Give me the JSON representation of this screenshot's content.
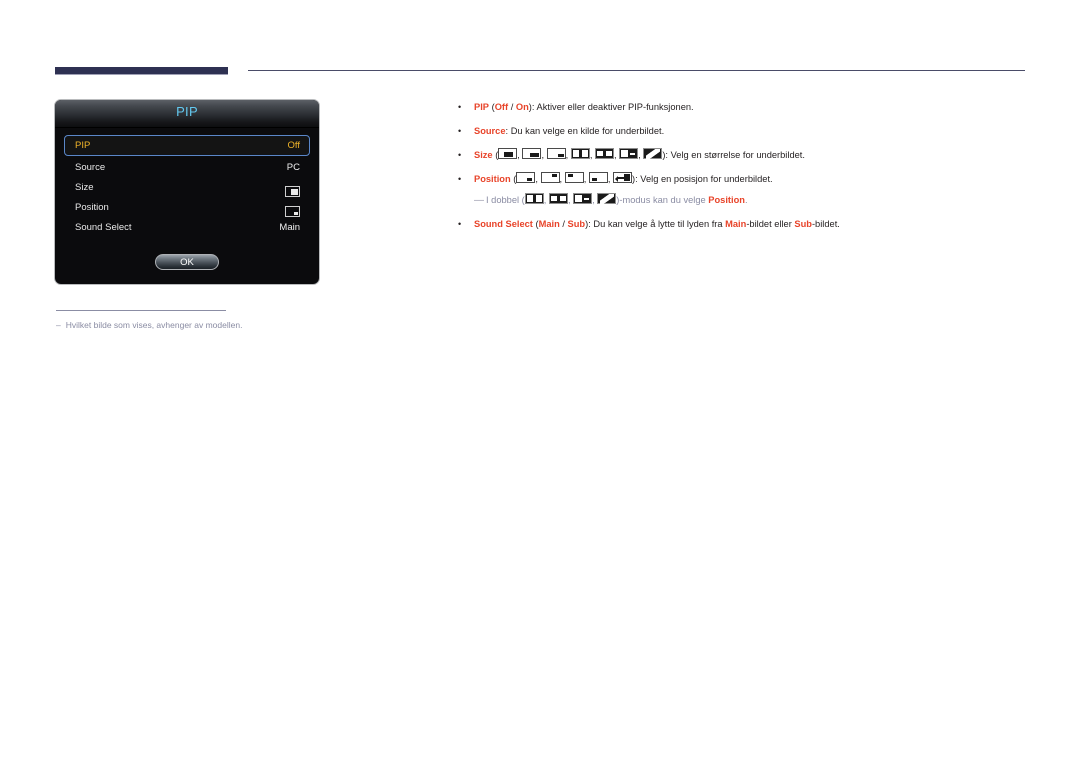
{
  "header": {
    "accent_color": "#2e3152",
    "rule_color": "#4a4c68"
  },
  "osd_dialog": {
    "title": "PIP",
    "title_color": "#63c9f0",
    "selected_color": "#f0b429",
    "rows": [
      {
        "label": "PIP",
        "value": "Off",
        "value_type": "text",
        "selected": true
      },
      {
        "label": "Source",
        "value": "PC",
        "value_type": "text",
        "selected": false
      },
      {
        "label": "Size",
        "value": "",
        "value_type": "icon-size",
        "selected": false
      },
      {
        "label": "Position",
        "value": "",
        "value_type": "icon-position",
        "selected": false
      },
      {
        "label": "Sound Select",
        "value": "Main",
        "value_type": "text",
        "selected": false
      }
    ],
    "ok_label": "OK"
  },
  "footnote": {
    "dash": "–",
    "text": "Hvilket bilde som vises, avhenger av modellen."
  },
  "bullets": {
    "marker": "•",
    "items": [
      {
        "id": "bullet-pip",
        "parts": [
          {
            "t": "PIP",
            "style": "key"
          },
          {
            "t": " (",
            "style": "plain"
          },
          {
            "t": "Off",
            "style": "key"
          },
          {
            "t": " / ",
            "style": "plain"
          },
          {
            "t": "On",
            "style": "key"
          },
          {
            "t": "): Aktiver eller deaktiver PIP-funksjonen.",
            "style": "plain"
          }
        ]
      },
      {
        "id": "bullet-source",
        "parts": [
          {
            "t": "Source",
            "style": "key"
          },
          {
            "t": ": Du kan velge en kilde for underbildet.",
            "style": "plain"
          }
        ]
      },
      {
        "id": "bullet-size",
        "parts": [
          {
            "t": "Size",
            "style": "key"
          },
          {
            "t": " (",
            "style": "plain"
          },
          {
            "t": "",
            "style": "icons-size"
          },
          {
            "t": "): Velg en størrelse for underbildet.",
            "style": "plain"
          }
        ]
      },
      {
        "id": "bullet-position",
        "parts": [
          {
            "t": "Position",
            "style": "key"
          },
          {
            "t": " (",
            "style": "plain"
          },
          {
            "t": "",
            "style": "icons-position"
          },
          {
            "t": "): Velg en posisjon for underbildet.",
            "style": "plain"
          }
        ]
      }
    ],
    "sub_note": {
      "dash": "—",
      "pre_text": "I dobbel (",
      "post_text": ")-modus kan du velge ",
      "keyword": "Position",
      "end_text": "."
    },
    "sound_select": {
      "parts": [
        {
          "t": "Sound Select",
          "style": "key"
        },
        {
          "t": " (",
          "style": "plain"
        },
        {
          "t": "Main",
          "style": "key"
        },
        {
          "t": " / ",
          "style": "plain"
        },
        {
          "t": "Sub",
          "style": "key"
        },
        {
          "t": "): Du kan velge å lytte til lyden fra ",
          "style": "plain"
        },
        {
          "t": "Main",
          "style": "key"
        },
        {
          "t": "-bildet eller ",
          "style": "plain"
        },
        {
          "t": "Sub",
          "style": "key"
        },
        {
          "t": "-bildet.",
          "style": "plain"
        }
      ]
    }
  },
  "icons": {
    "size_set": [
      "size-small-center-icon",
      "size-medium-right-icon",
      "size-tiny-corner-icon",
      "size-double-wide-icon",
      "size-double-short-icon",
      "size-double-dash-icon",
      "size-diagonal-icon"
    ],
    "position_set": [
      "position-bottom-right-icon",
      "position-top-right-icon",
      "position-top-left-icon",
      "position-bottom-left-icon",
      "position-move-icon"
    ],
    "double_set": [
      "size-double-wide-icon",
      "size-double-short-icon",
      "size-double-dash-icon",
      "size-diagonal-icon"
    ]
  },
  "colors": {
    "keyword_red": "#e8442a",
    "body_text": "#231f20",
    "muted": "#8a8ca3"
  }
}
